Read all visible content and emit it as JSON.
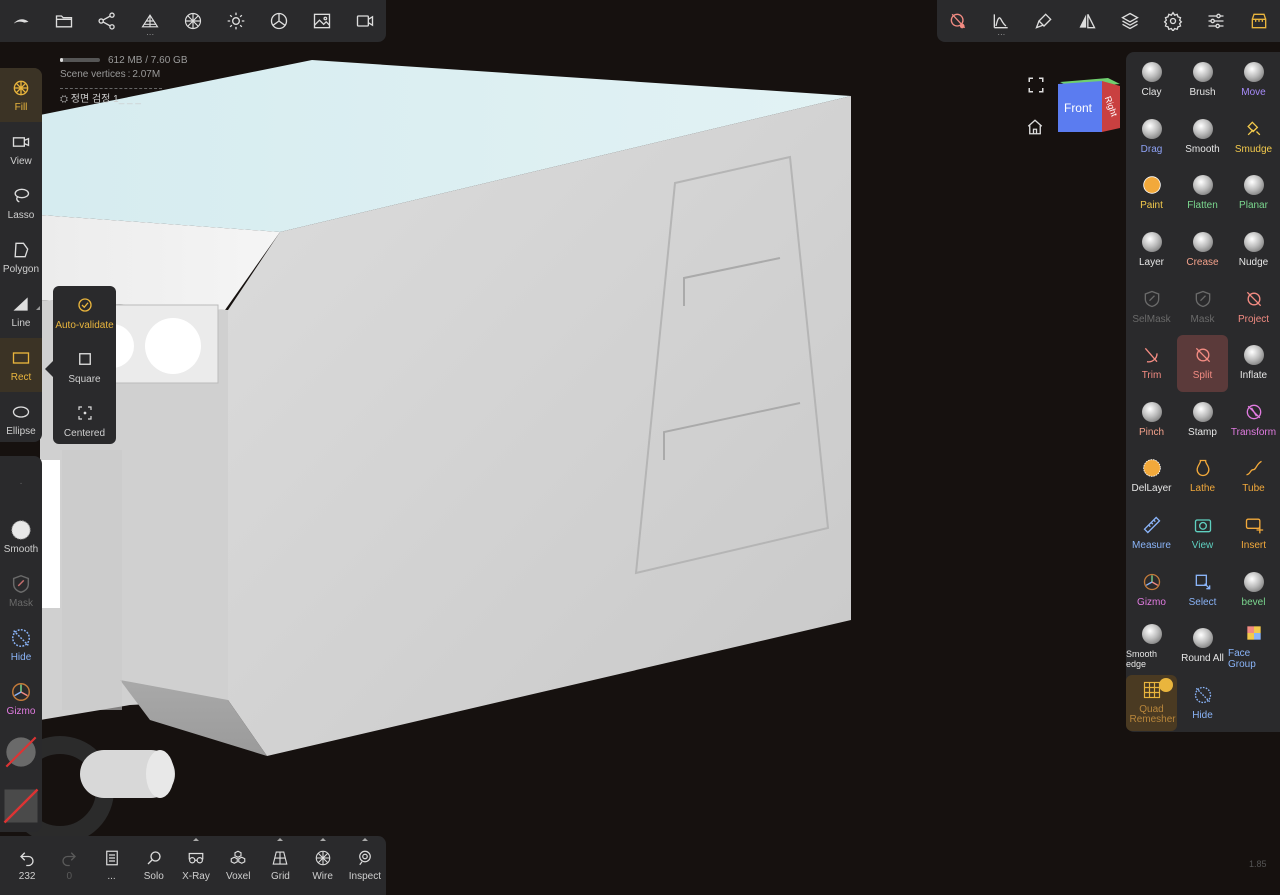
{
  "top_left_toolbar": {
    "items": [
      {
        "name": "logo-icon"
      },
      {
        "name": "folder-icon"
      },
      {
        "name": "scene-graph-icon"
      },
      {
        "name": "multires-icon",
        "has_menu": true
      },
      {
        "name": "topology-icon"
      },
      {
        "name": "light-icon"
      },
      {
        "name": "material-icon"
      },
      {
        "name": "background-image-icon"
      },
      {
        "name": "video-camera-icon"
      }
    ]
  },
  "top_right_toolbar": {
    "items": [
      {
        "name": "tool-split-icon"
      },
      {
        "name": "curve-icon",
        "has_menu": true
      },
      {
        "name": "paint-brush-icon"
      },
      {
        "name": "symmetry-icon"
      },
      {
        "name": "layers-icon"
      },
      {
        "name": "settings-gear-icon"
      },
      {
        "name": "sliders-icon"
      },
      {
        "name": "shop-icon"
      }
    ]
  },
  "stats": {
    "memory": "612 MB / 7.60 GB",
    "memory_fraction": 0.08,
    "vertices": "Scene vertices : 2.07M",
    "view_name": "정면 검정 1_ _ _"
  },
  "left_tools": {
    "items": [
      {
        "label": "Fill",
        "icon": "fill-icon",
        "active": true
      },
      {
        "label": "View",
        "icon": "camera-icon"
      },
      {
        "label": "Lasso",
        "icon": "lasso-icon"
      },
      {
        "label": "Polygon",
        "icon": "polygon-icon"
      },
      {
        "label": "Line",
        "icon": "line-icon"
      },
      {
        "label": "Rect",
        "icon": "rect-icon",
        "active": true
      },
      {
        "label": "Ellipse",
        "icon": "ellipse-icon"
      }
    ]
  },
  "rect_popup": {
    "items": [
      {
        "label": "Auto-validate",
        "icon": "check-circle-icon",
        "active": true
      },
      {
        "label": "Square",
        "icon": "square-icon"
      },
      {
        "label": "Centered",
        "icon": "centered-icon"
      }
    ]
  },
  "left_bottom": {
    "items": [
      {
        "label": "Smooth",
        "icon": "smooth-icon"
      },
      {
        "label": "Mask",
        "icon": "mask-icon",
        "disabled": true
      },
      {
        "label": "Hide",
        "icon": "hide-icon"
      },
      {
        "label": "Gizmo",
        "icon": "gizmo-icon"
      }
    ]
  },
  "bottom_bar": {
    "items": [
      {
        "label": "232",
        "icon": "undo-icon"
      },
      {
        "label": "0",
        "icon": "redo-icon",
        "disabled": true
      },
      {
        "label": "...",
        "icon": "page-icon"
      },
      {
        "label": "Solo",
        "icon": "search-icon"
      },
      {
        "label": "X-Ray",
        "icon": "xray-glasses-icon",
        "has_menu": true
      },
      {
        "label": "Voxel",
        "icon": "voxel-icon"
      },
      {
        "label": "Grid",
        "icon": "grid-icon",
        "has_menu": true
      },
      {
        "label": "Wire",
        "icon": "wireframe-icon",
        "has_menu": true
      },
      {
        "label": "Inspect",
        "icon": "inspect-icon",
        "has_menu": true
      }
    ]
  },
  "orientation": {
    "front": "Front",
    "right": "Right"
  },
  "right_tools": {
    "items": [
      {
        "label": "Clay",
        "color": "#e6e6e6",
        "icon": "ball"
      },
      {
        "label": "Brush",
        "color": "#e6e6e6",
        "icon": "ball"
      },
      {
        "label": "Move",
        "color": "#a78bfa",
        "icon": "ball"
      },
      {
        "label": "Drag",
        "color": "#8ea2f5",
        "icon": "ball"
      },
      {
        "label": "Smooth",
        "color": "#e6e6e6",
        "icon": "ball"
      },
      {
        "label": "Smudge",
        "color": "#f2c94c",
        "icon": "smudge"
      },
      {
        "label": "Paint",
        "color": "#f2c94c",
        "icon": "ball-paint"
      },
      {
        "label": "Flatten",
        "color": "#7bd88f",
        "icon": "ball"
      },
      {
        "label": "Planar",
        "color": "#7bd88f",
        "icon": "ball"
      },
      {
        "label": "Layer",
        "color": "#e6e6e6",
        "icon": "ball"
      },
      {
        "label": "Crease",
        "color": "#f3a18b",
        "icon": "ball"
      },
      {
        "label": "Nudge",
        "color": "#e6e6e6",
        "icon": "ball"
      },
      {
        "label": "SelMask",
        "color": "#6a6a6a",
        "icon": "shield"
      },
      {
        "label": "Mask",
        "color": "#6a6a6a",
        "icon": "shield"
      },
      {
        "label": "Project",
        "color": "#f28b82",
        "icon": "split"
      },
      {
        "label": "Trim",
        "color": "#f28b82",
        "icon": "trim"
      },
      {
        "label": "Split",
        "color": "#f28b82",
        "icon": "split",
        "selected": true
      },
      {
        "label": "Inflate",
        "color": "#e6e6e6",
        "icon": "ball"
      },
      {
        "label": "Pinch",
        "color": "#f3a18b",
        "icon": "ball"
      },
      {
        "label": "Stamp",
        "color": "#e6e6e6",
        "icon": "ball"
      },
      {
        "label": "Transform",
        "color": "#e07be0",
        "icon": "transform"
      },
      {
        "label": "DelLayer",
        "color": "#e6e6e6",
        "icon": "dellayer"
      },
      {
        "label": "Lathe",
        "color": "#f2a93b",
        "icon": "lathe"
      },
      {
        "label": "Tube",
        "color": "#f2a93b",
        "icon": "tube"
      },
      {
        "label": "Measure",
        "color": "#8ab4f8",
        "icon": "ruler"
      },
      {
        "label": "View",
        "color": "#5fd0c0",
        "icon": "camera"
      },
      {
        "label": "Insert",
        "color": "#f2a93b",
        "icon": "insert"
      },
      {
        "label": "Gizmo",
        "color": "#e07be0",
        "icon": "gizmo"
      },
      {
        "label": "Select",
        "color": "#8ab4f8",
        "icon": "select"
      },
      {
        "label": "bevel",
        "color": "#7bd88f",
        "icon": "ball"
      },
      {
        "label": "Smooth edge",
        "color": "#e6e6e6",
        "icon": "ball"
      },
      {
        "label": "Round All",
        "color": "#e6e6e6",
        "icon": "ball"
      },
      {
        "label": "Face Group",
        "color": "#8ab4f8",
        "icon": "facegroup"
      },
      {
        "label": "Quad Remesher",
        "color": "#b8863b",
        "icon": "quad",
        "badge": true
      },
      {
        "label": "Hide",
        "color": "#8ab4f8",
        "icon": "hide"
      }
    ]
  },
  "version": "1.85",
  "colors": {
    "accent": "#e9b53d",
    "panel": "#2a2a2c",
    "background": "#16110f"
  }
}
